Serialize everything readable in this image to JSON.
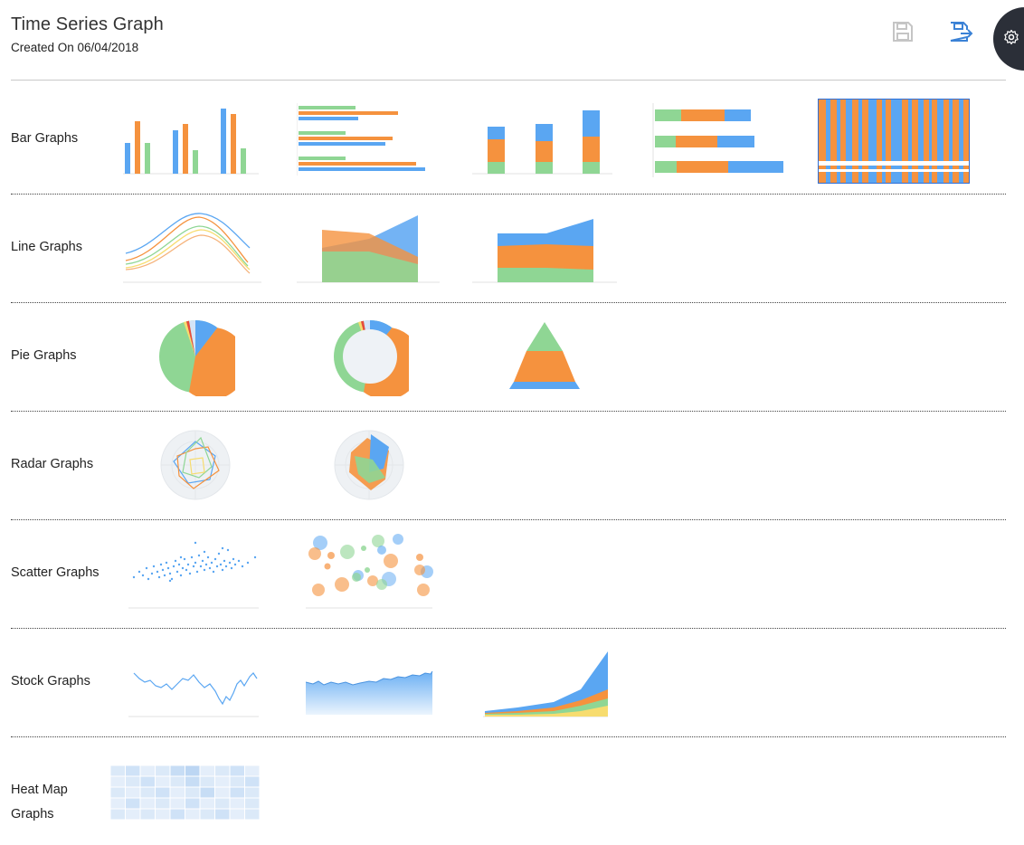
{
  "header": {
    "title": "Time Series Graph",
    "subtitle": "Created On 06/04/2018"
  },
  "toolbar": {
    "save_icon": "save-icon",
    "save_as_icon": "save-as-icon",
    "settings_icon": "gear-icon"
  },
  "colors": {
    "blue": "#5aa6f2",
    "orange": "#f5923e",
    "green": "#8fd694",
    "yellow": "#f7dc6f",
    "red": "#e74c3c",
    "selected_outline": "#2f6fd6",
    "settings_bg": "#2b2f38"
  },
  "categories": [
    {
      "label": "Bar Graphs"
    },
    {
      "label": "Line Graphs"
    },
    {
      "label": "Pie Graphs"
    },
    {
      "label": "Radar Graphs"
    },
    {
      "label": "Scatter Graphs"
    },
    {
      "label": "Stock Graphs"
    },
    {
      "label": "Heat Map Graphs"
    }
  ]
}
